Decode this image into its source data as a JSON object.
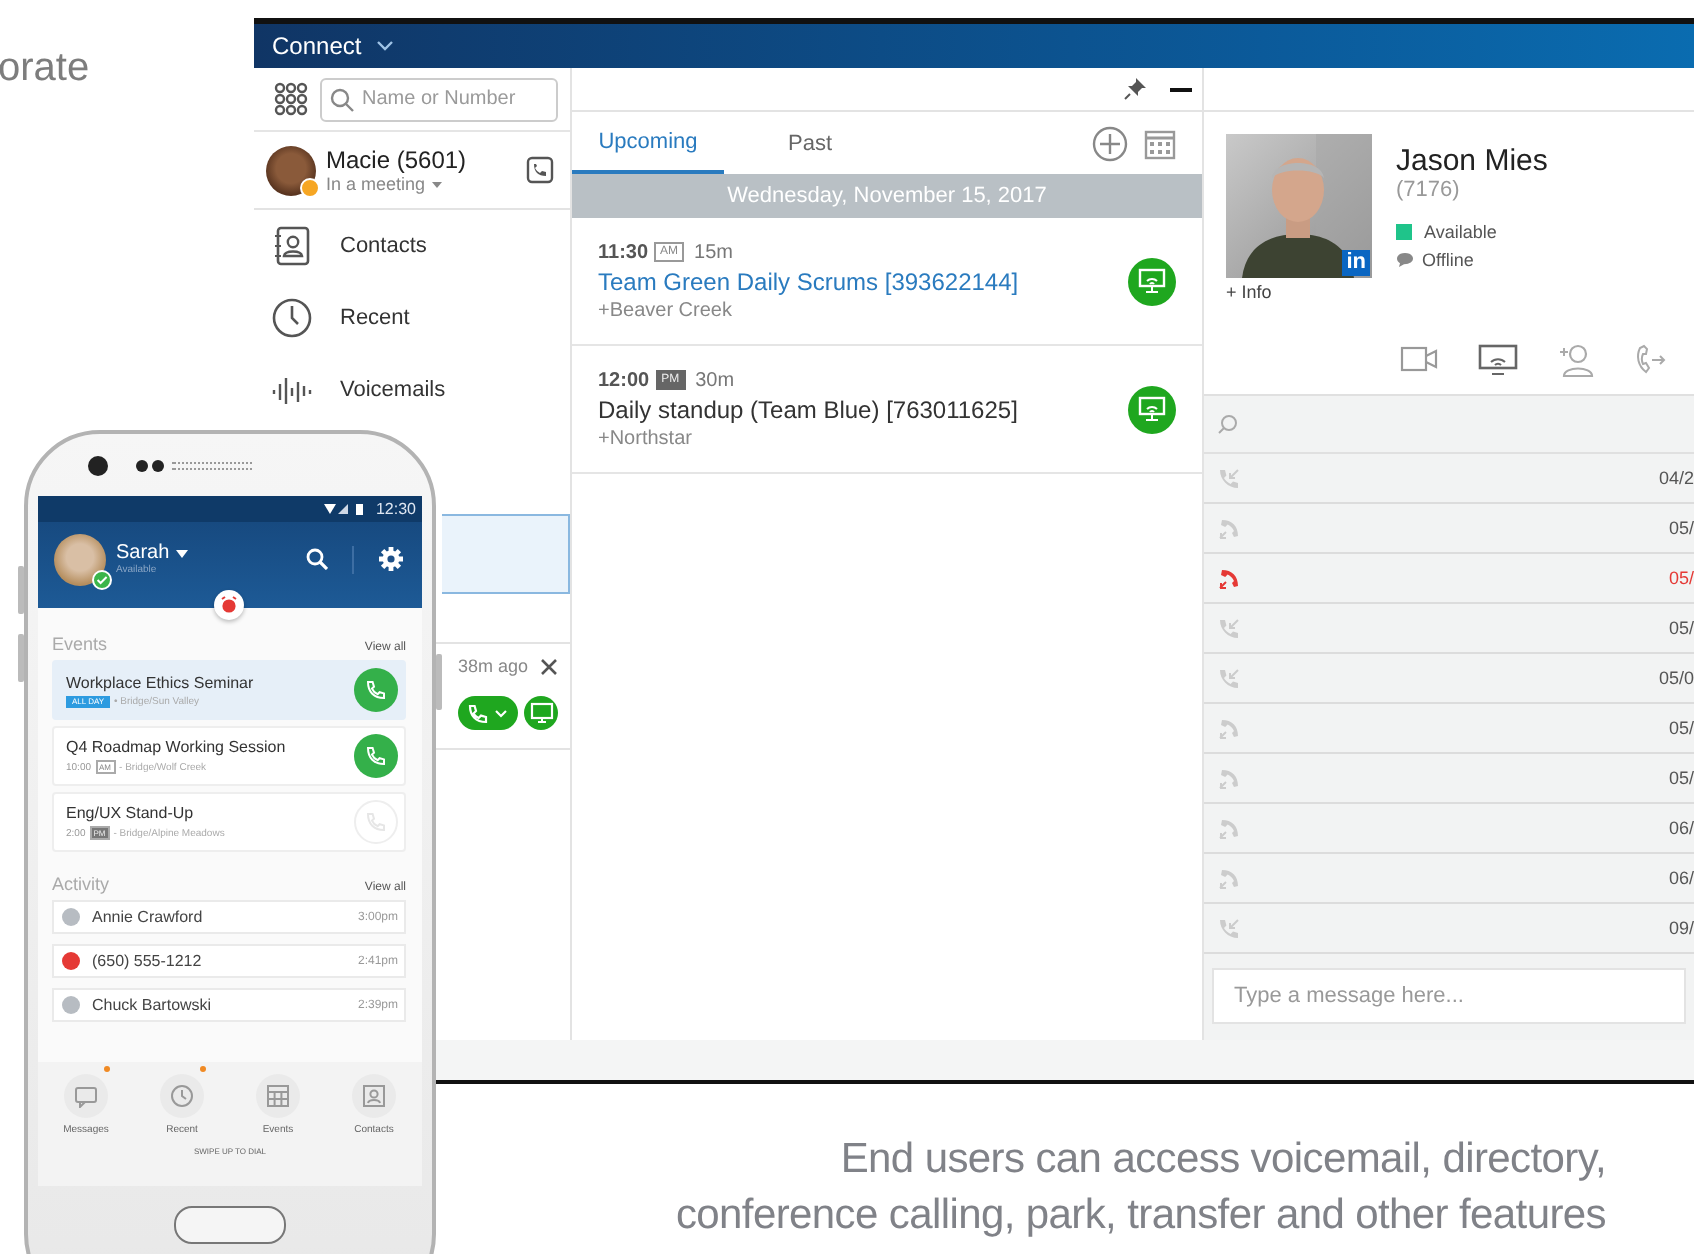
{
  "page": {
    "heading_fragment": "orate",
    "caption_lines": [
      "End users can access voicemail, directory,",
      "conference calling, park, transfer and other features"
    ]
  },
  "desktop": {
    "title": "Connect",
    "search": {
      "placeholder": "Name or Number"
    },
    "user": {
      "name": "Macie (5601)",
      "status": "In a meeting"
    },
    "nav": [
      {
        "label": "Contacts",
        "selected": false
      },
      {
        "label": "Recent",
        "selected": false
      },
      {
        "label": "Voicemails",
        "selected": false
      },
      {
        "selected": true
      }
    ],
    "notification": {
      "time": "38m ago"
    },
    "tabs": [
      {
        "label": "Upcoming",
        "selected": true
      },
      {
        "label": "Past",
        "selected": false
      }
    ],
    "date_header": "Wednesday, November 15, 2017",
    "events": [
      {
        "time": "11:30",
        "meridiem": "AM",
        "duration": "15m",
        "title": "Team Green Daily Scrums [393622144]",
        "location": "+Beaver Creek",
        "highlighted": true
      },
      {
        "time": "12:00",
        "meridiem": "PM",
        "duration": "30m",
        "title": "Daily standup (Team Blue) [763011625]",
        "location": "+Northstar",
        "highlighted": false
      }
    ],
    "contact": {
      "name": "Jason Mies",
      "extension": "(7176)",
      "presence": "Available",
      "chat_status": "Offline",
      "badge": "in",
      "info_link": "+ Info"
    },
    "history": [
      {
        "kind": "incoming",
        "date": "04/2"
      },
      {
        "kind": "outgoing",
        "date": "05/"
      },
      {
        "kind": "missed",
        "date": "05/"
      },
      {
        "kind": "incoming",
        "date": "05/"
      },
      {
        "kind": "incoming",
        "date": "05/0"
      },
      {
        "kind": "outgoing",
        "date": "05/"
      },
      {
        "kind": "outgoing",
        "date": "05/"
      },
      {
        "kind": "outgoing",
        "date": "06/"
      },
      {
        "kind": "outgoing",
        "date": "06/"
      },
      {
        "kind": "incoming",
        "date": "09/"
      }
    ],
    "message": {
      "placeholder": "Type a message here..."
    }
  },
  "phone": {
    "clock": "12:30",
    "user": {
      "name": "Sarah",
      "status": "Available"
    },
    "events_heading": "Events",
    "events_link": "View all",
    "events": [
      {
        "title": "Workplace Ethics Seminar",
        "tag": "ALL DAY",
        "location": "• Bridge/Sun Valley",
        "selected": true,
        "joinable": true
      },
      {
        "title": "Q4 Roadmap Working Session",
        "time": "10:00",
        "meridiem": "AM",
        "location": "- Bridge/Wolf Creek",
        "selected": false,
        "joinable": true
      },
      {
        "title": "Eng/UX Stand-Up",
        "time": "2:00",
        "meridiem": "PM",
        "location": "- Bridge/Alpine Meadows",
        "selected": false,
        "joinable": false
      }
    ],
    "activity_heading": "Activity",
    "activity_link": "View all",
    "activity": [
      {
        "name": "Annie Crawford",
        "time": "3:00pm",
        "missed": false
      },
      {
        "name": "(650) 555-1212",
        "time": "2:41pm",
        "missed": true
      },
      {
        "name": "Chuck Bartowski",
        "time": "2:39pm",
        "missed": false
      }
    ],
    "tabs": [
      {
        "label": "Messages",
        "badge": true
      },
      {
        "label": "Recent",
        "badge": true
      },
      {
        "label": "Events",
        "badge": false
      },
      {
        "label": "Contacts",
        "badge": false
      }
    ],
    "swipe_hint": "SWIPE UP TO DIAL"
  }
}
